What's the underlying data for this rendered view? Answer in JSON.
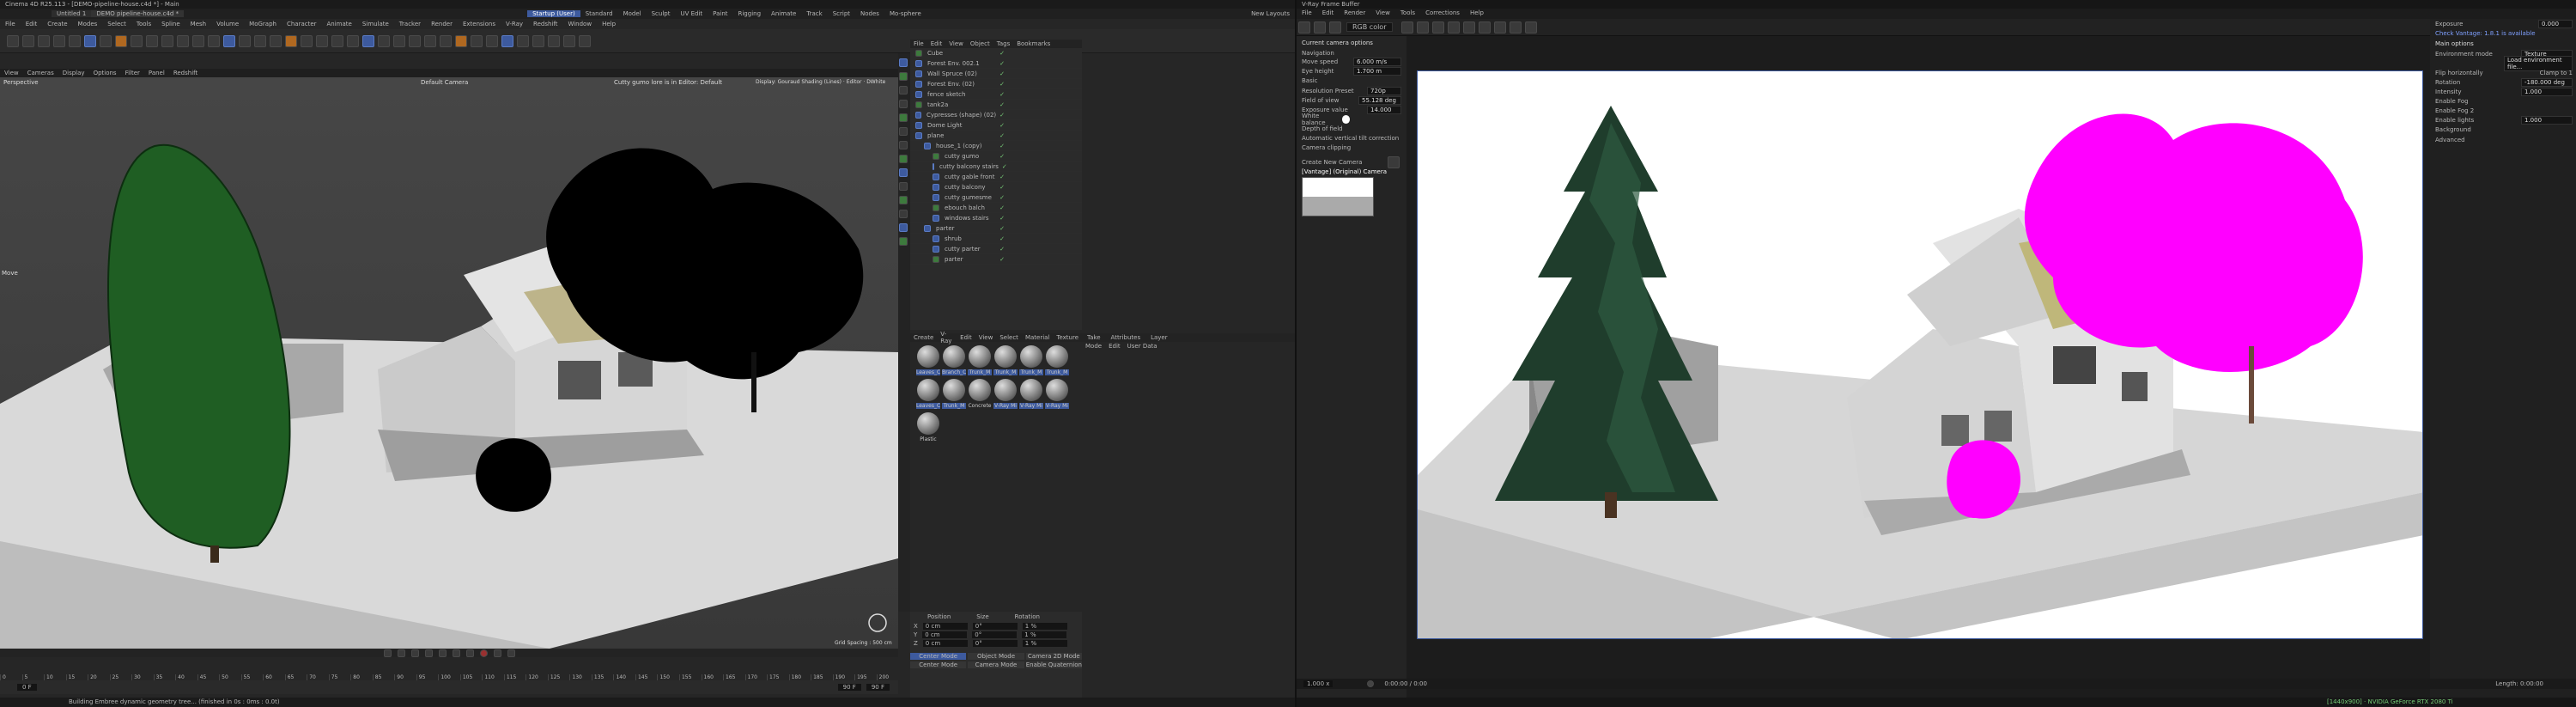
{
  "c4d": {
    "title": "Cinema 4D R25.113 - [DEMO-pipeline-house.c4d *] - Main",
    "tabs": [
      "Untitled 1",
      "DEMO pipeline-house.c4d *"
    ],
    "menu": [
      "File",
      "Edit",
      "Create",
      "Modes",
      "Select",
      "Tools",
      "Spline",
      "Mesh",
      "Volume",
      "MoGraph",
      "Character",
      "Animate",
      "Simulate",
      "Tracker",
      "Render",
      "Extensions",
      "V-Ray",
      "Redshift",
      "Window",
      "Help"
    ],
    "layout_tabs": [
      "Startup (User)",
      "Standard",
      "Model",
      "Sculpt",
      "UV Edit",
      "Paint",
      "Rigging",
      "Animate",
      "Track",
      "Script",
      "Nodes",
      "Mo-sphere"
    ],
    "new_layouts": "New Layouts",
    "viewport_menu": [
      "View",
      "Cameras",
      "Display",
      "Options",
      "Filter",
      "Panel",
      "Redshift"
    ],
    "viewport_label": "Perspective",
    "camera_label": "Default Camera",
    "viewport_info": "Cutty gumo lore is in Editor: Default",
    "viewport_right": "Display: Gouraud Shading (Lines) · Editor · DWhite",
    "move_label": "Move",
    "grid_spacing": "Grid Spacing : 500 cm",
    "objects_menu": [
      "File",
      "Edit",
      "View",
      "Object",
      "Tags",
      "Bookmarks"
    ],
    "objects": [
      {
        "name": "Cube",
        "indent": 0
      },
      {
        "name": "Forest Env. 002.1",
        "indent": 0
      },
      {
        "name": "Wall Spruce (02)",
        "indent": 0
      },
      {
        "name": "Forest Env. (02)",
        "indent": 0
      },
      {
        "name": "fence sketch",
        "indent": 0
      },
      {
        "name": "tank2a",
        "indent": 0
      },
      {
        "name": "Cypresses (shape) (02)",
        "indent": 0
      },
      {
        "name": "Dome Light",
        "indent": 0
      },
      {
        "name": "plane",
        "indent": 0
      },
      {
        "name": "house_1 (copy)",
        "indent": 1
      },
      {
        "name": "cutty gumo",
        "indent": 2
      },
      {
        "name": "cutty balcony stairs",
        "indent": 2
      },
      {
        "name": "cutty gable front",
        "indent": 2
      },
      {
        "name": "cutty balcony",
        "indent": 2
      },
      {
        "name": "cutty gumesme",
        "indent": 2
      },
      {
        "name": "ebouch balch",
        "indent": 2
      },
      {
        "name": "windows stairs",
        "indent": 2
      },
      {
        "name": "parter",
        "indent": 1
      },
      {
        "name": "shrub",
        "indent": 2
      },
      {
        "name": "cutty parter",
        "indent": 2
      },
      {
        "name": "parter",
        "indent": 2
      }
    ],
    "materials_menu": [
      "Create",
      "V-Ray",
      "Edit",
      "View",
      "Select",
      "Material",
      "Texture"
    ],
    "materials": [
      {
        "name": "Leaves_C",
        "sel": true
      },
      {
        "name": "Branch_C",
        "sel": true
      },
      {
        "name": "Trunk_M",
        "sel": true
      },
      {
        "name": "Trunk_M",
        "sel": true
      },
      {
        "name": "Trunk_M",
        "sel": true
      },
      {
        "name": "Trunk_M",
        "sel": true
      },
      {
        "name": "Leaves_C",
        "sel": true
      },
      {
        "name": "Trunk_M",
        "sel": true
      },
      {
        "name": "Concrete",
        "sel": false
      },
      {
        "name": "V-Ray Mi",
        "sel": true
      },
      {
        "name": "V-Ray Mi",
        "sel": true
      },
      {
        "name": "V-Ray Mi",
        "sel": true
      },
      {
        "name": "Plastic",
        "sel": false
      }
    ],
    "attr_tabs": [
      "Take",
      "Attributes",
      "Layer"
    ],
    "attr_menu": [
      "Mode",
      "Edit",
      "User Data"
    ],
    "coord_headers": [
      "Position",
      "Size",
      "Rotation"
    ],
    "coord_rows": [
      [
        "X",
        "0 cm",
        "0°",
        "1 %"
      ],
      [
        "Y",
        "0 cm",
        "0°",
        "1 %"
      ],
      [
        "Z",
        "0 cm",
        "0°",
        "1 %"
      ]
    ],
    "mode_buttons": [
      "Center Mode",
      "Object Mode",
      "Camera 2D Mode"
    ],
    "mode_buttons2": [
      "Center Mode",
      "Camera Mode",
      "Enable Quaternion"
    ],
    "timeline_ticks": [
      "0",
      "5",
      "10",
      "15",
      "20",
      "25",
      "30",
      "35",
      "40",
      "45",
      "50",
      "55",
      "60",
      "65",
      "70",
      "75",
      "80",
      "85",
      "90",
      "95",
      "100",
      "105",
      "110",
      "115",
      "120",
      "125",
      "130",
      "135",
      "140",
      "145",
      "150",
      "155",
      "160",
      "165",
      "170",
      "175",
      "180",
      "185",
      "190",
      "195",
      "200"
    ],
    "frame_field": "0 F",
    "frame_end": "90 F",
    "frame_end2": "90 F",
    "status": "Building Embree dynamic geometry tree... (finished in 0s : 0ms : 0.0t)"
  },
  "vray": {
    "title": "V-Ray Frame Buffer",
    "menu": [
      "File",
      "Edit",
      "Render",
      "View",
      "Tools",
      "Corrections",
      "Help"
    ],
    "toolbar_field": "RGB color",
    "camera_panel": {
      "title": "Current camera options",
      "navigation": "Navigation",
      "move_speed_label": "Move speed",
      "move_speed": "6.000 m/s",
      "eye_height_label": "Eye height",
      "eye_height": "1.700 m",
      "lens_title": "Basic",
      "resolution_label": "Resolution Preset",
      "resolution": "720p",
      "fov_label": "Field of view",
      "fov": "55.128 deg",
      "exposure_label": "Exposure value",
      "exposure": "14.000",
      "white_balance_label": "White balance",
      "dof_label": "Depth of field",
      "vertical_tilt_label": "Automatic vertical tilt correction",
      "clipping_label": "Camera clipping",
      "create_camera_label": "Create New Camera",
      "preview_label": "[Vantage] (Original) Camera"
    },
    "right_panel": {
      "exposure_label": "Exposure",
      "exposure_value": "0.000",
      "check_label": "Check Vantage: 1.8.1 is available",
      "sections": [
        "Main options",
        "Environment mode"
      ],
      "env_mode": "Texture",
      "env_file": "Load environment file...",
      "flip_label": "Flip horizontally",
      "clamp_label": "Clamp to 1",
      "rotation_label": "Rotation",
      "rotation_value": "-180.000 deg",
      "intensity_label": "Intensity",
      "intensity_value": "1.000",
      "fog_label": "Enable Fog",
      "fog2_label": "Enable Fog 2",
      "lights_label": "Enable lights",
      "lights_value": "1.000",
      "background_label": "Background",
      "advanced_label": "Advanced"
    },
    "zoom": "1.000 x",
    "time": "0:00:00 / 0:00",
    "status_left": "[1440x900] · NVIDIA GeForce RTX 2080 Ti",
    "status_right": "Length: 0:00:00",
    "colors": {
      "accent": "#3d5a9e",
      "magenta": "#ff00ff"
    }
  }
}
